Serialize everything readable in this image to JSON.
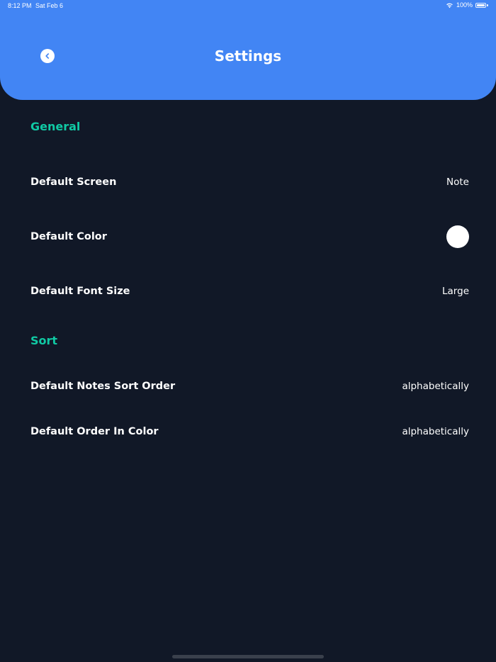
{
  "status_bar": {
    "time": "8:12 PM",
    "date": "Sat Feb 6",
    "battery": "100%",
    "wifi_icon": "wifi-icon",
    "battery_icon": "battery-icon"
  },
  "header": {
    "title": "Settings",
    "back_icon": "chevron-left-icon",
    "background_color": "#4285F4"
  },
  "sections": {
    "general": {
      "title": "General",
      "items": [
        {
          "label": "Default Screen",
          "value": "Note"
        },
        {
          "label": "Default Color",
          "value_color": "#FFFFFF"
        },
        {
          "label": "Default Font Size",
          "value": "Large"
        }
      ]
    },
    "sort": {
      "title": "Sort",
      "items": [
        {
          "label": "Default Notes Sort Order",
          "value": "alphabetically"
        },
        {
          "label": "Default Order In Color",
          "value": "alphabetically"
        }
      ]
    }
  },
  "colors": {
    "background": "#111827",
    "accent": "#10C9A4",
    "text": "#FFFFFF"
  }
}
